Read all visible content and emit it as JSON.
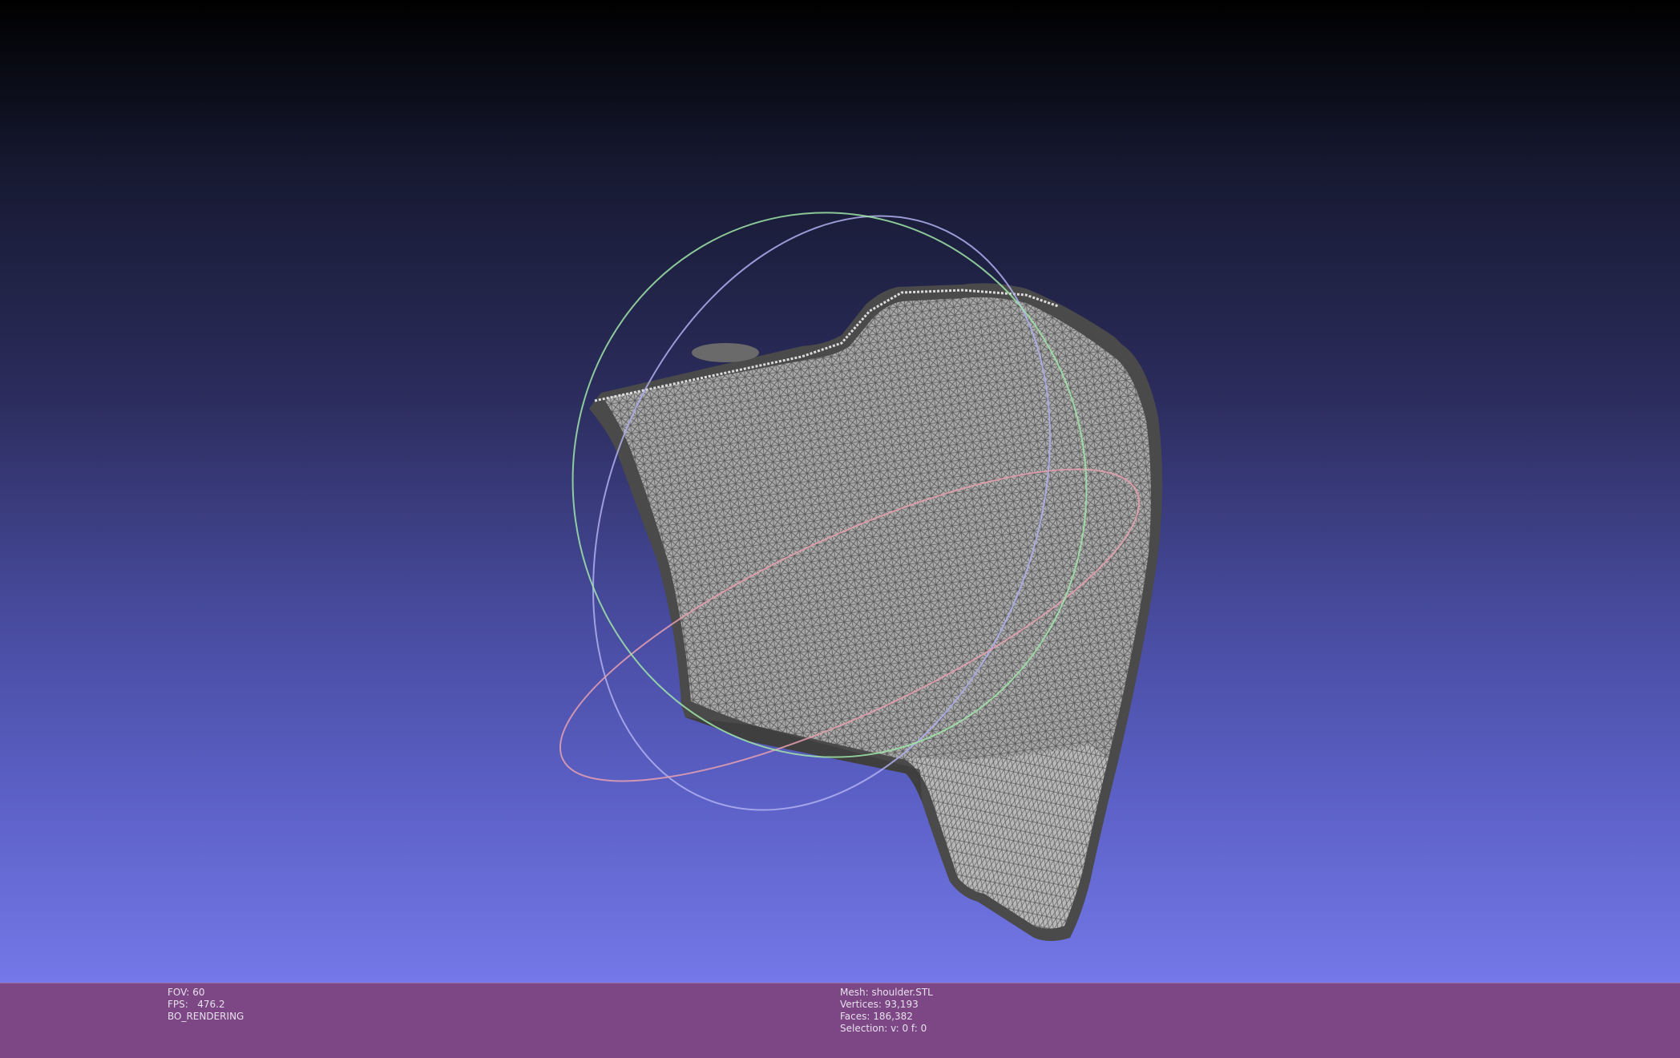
{
  "render_info": {
    "fov": "FOV: 60",
    "fps": "FPS:   476.2",
    "mode": "BO_RENDERING"
  },
  "mesh_info": {
    "mesh": "Mesh: shoulder.STL",
    "vertices": "Vertices: 93,193",
    "faces": "Faces: 186,382",
    "selection": "Selection: v: 0 f: 0"
  },
  "colors": {
    "viewport_top": "#000000",
    "viewport_bottom": "#7478e8",
    "status_bar": "#7d4785",
    "mesh_edge": "#4a4a4a",
    "mesh_face": "#9a9a9a",
    "trackball_x": "#e6a0b0",
    "trackball_y": "#a0e6a8",
    "trackball_z": "#b0b0f0"
  },
  "icons": {
    "trackball": "trackball-gizmo-icon"
  }
}
